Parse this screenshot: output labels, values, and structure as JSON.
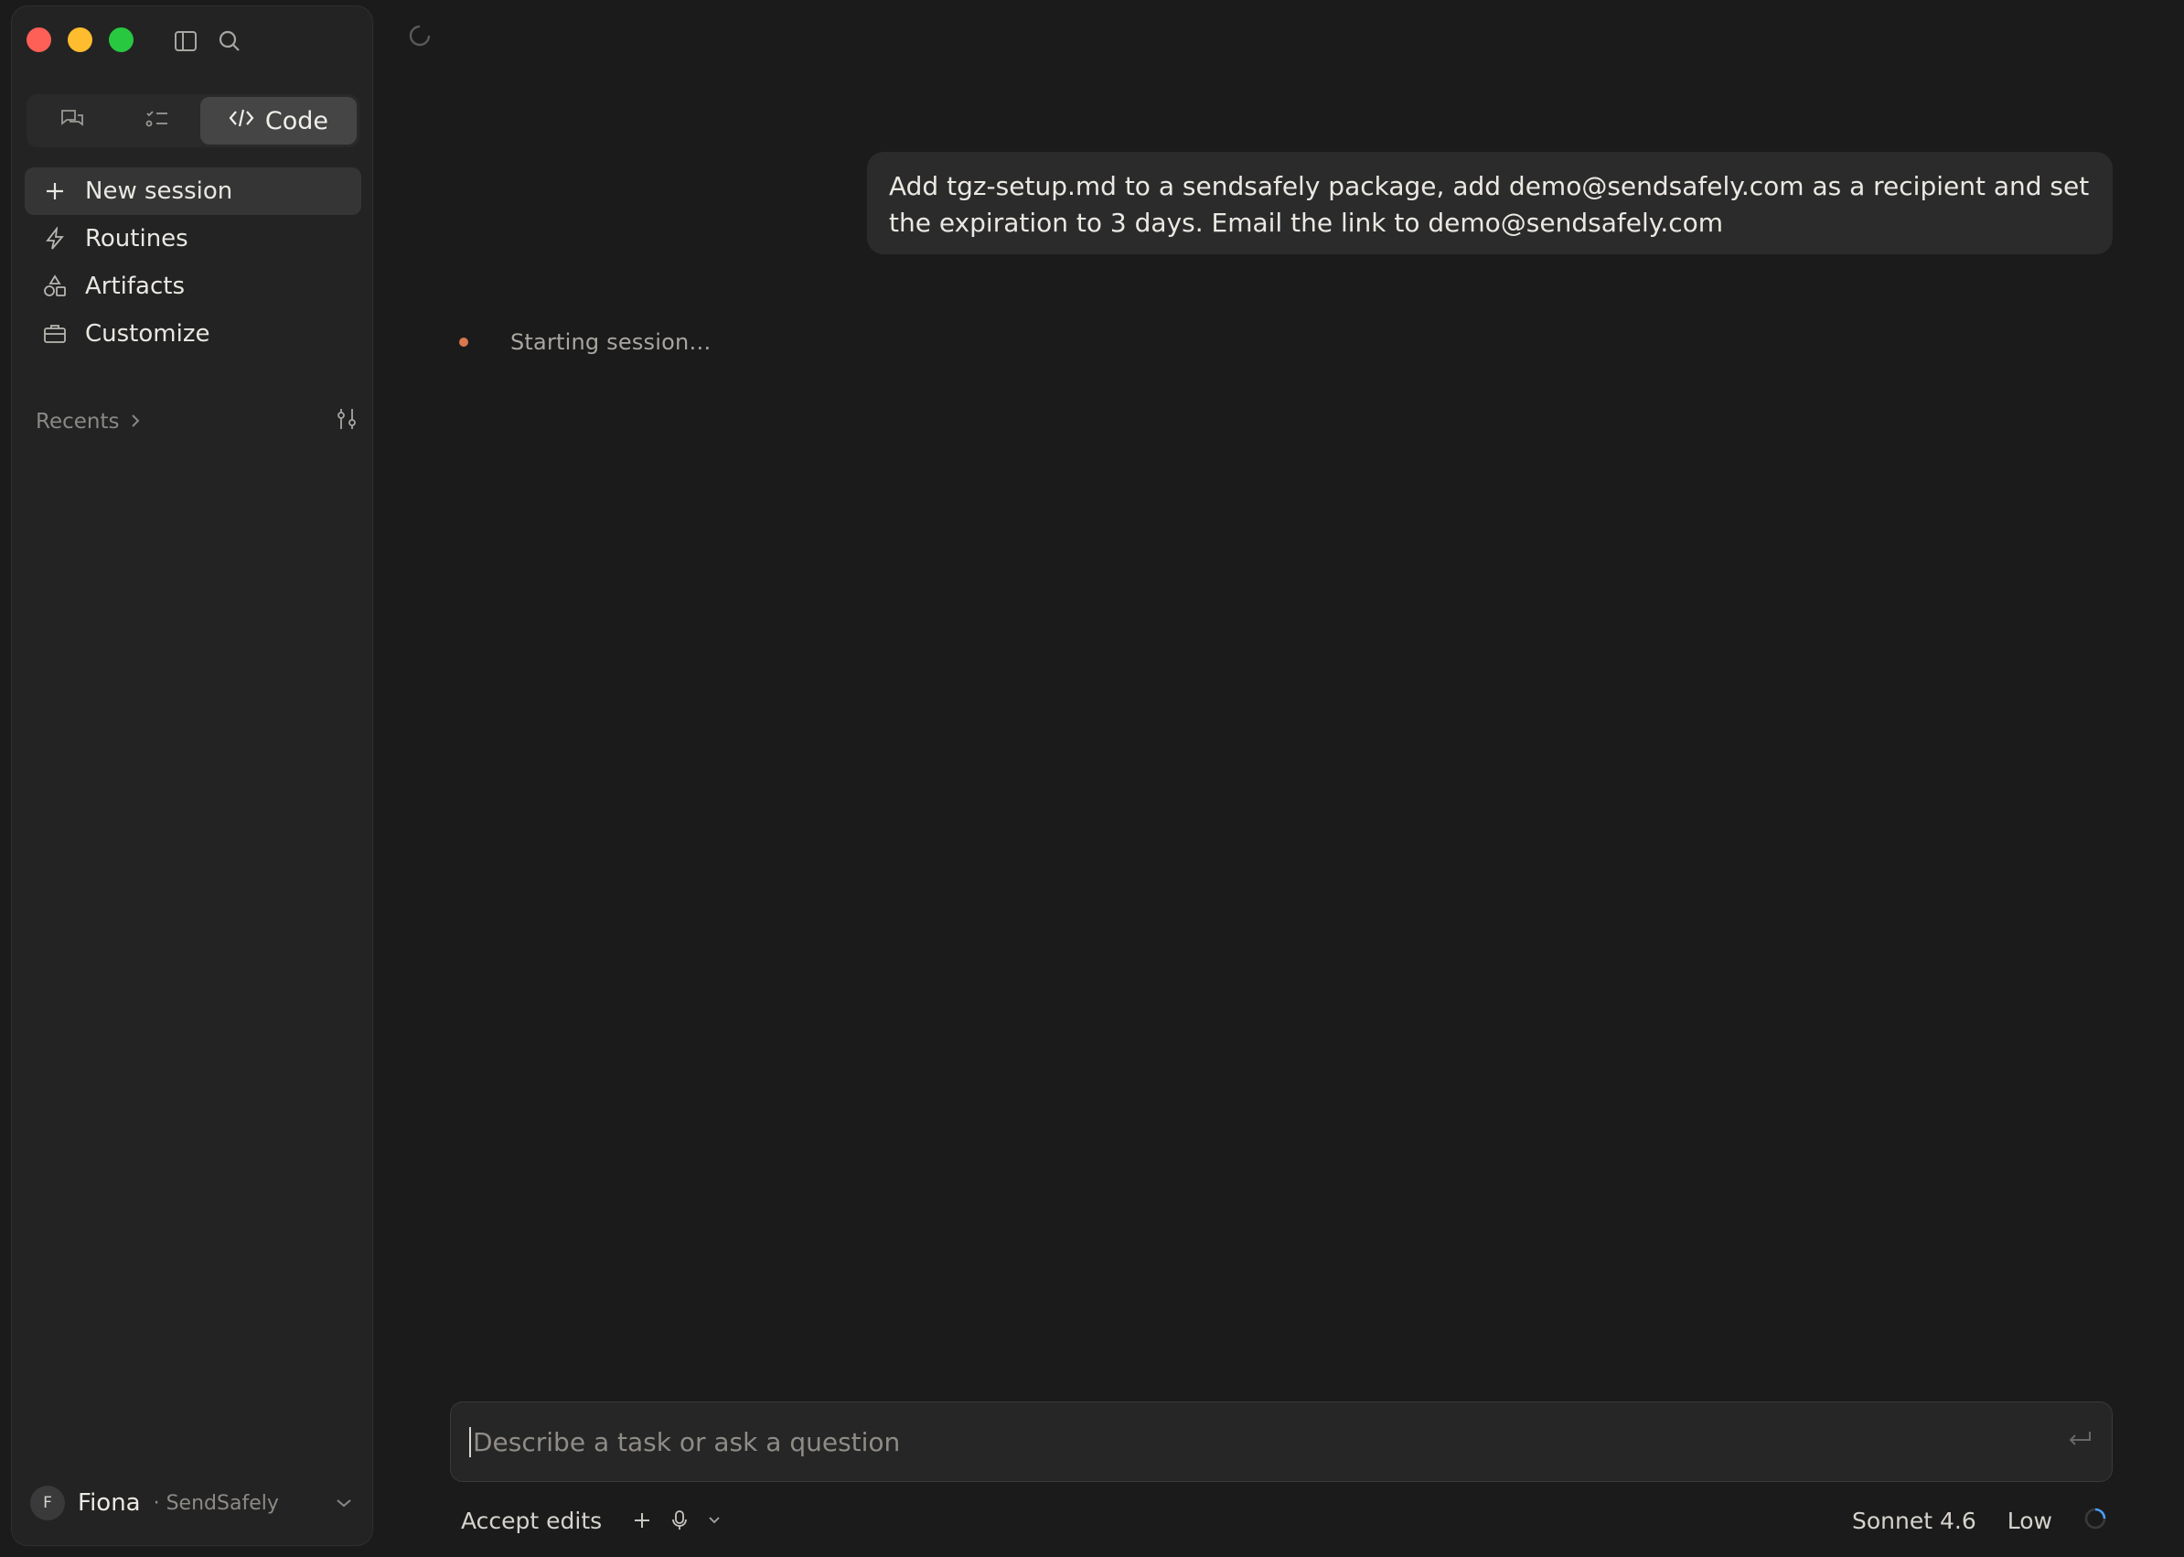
{
  "sidebar": {
    "window_controls": [
      "close",
      "minimize",
      "maximize"
    ],
    "top_icons": [
      "sidebar-toggle-icon",
      "search-icon"
    ],
    "modes": {
      "chat_icon": "chat-bubbles-icon",
      "tasks_icon": "checklist-icon",
      "code_label": "Code",
      "code_icon": "code-brackets-icon"
    },
    "nav": [
      {
        "label": "New session",
        "icon": "plus-icon",
        "active": true
      },
      {
        "label": "Routines",
        "icon": "bolt-icon",
        "active": false
      },
      {
        "label": "Artifacts",
        "icon": "shapes-icon",
        "active": false
      },
      {
        "label": "Customize",
        "icon": "briefcase-icon",
        "active": false
      }
    ],
    "recents_label": "Recents",
    "user": {
      "initial": "F",
      "name": "Fiona",
      "org": "· SendSafely"
    }
  },
  "main": {
    "user_message": "Add tgz-setup.md to a sendsafely package, add demo@sendsafely.com as a recipient and set the expiration to 3 days. Email the link to demo@sendsafely.com",
    "status_text": "Starting session…",
    "composer": {
      "placeholder": "Describe a task or ask a question",
      "value": ""
    },
    "toolbar": {
      "accept_label": "Accept edits",
      "model": "Sonnet 4.6",
      "effort": "Low"
    }
  },
  "colors": {
    "background": "#1b1b1b",
    "sidebar": "#232323",
    "status_dot": "#d9774f",
    "spinner": "#4a9eff"
  }
}
